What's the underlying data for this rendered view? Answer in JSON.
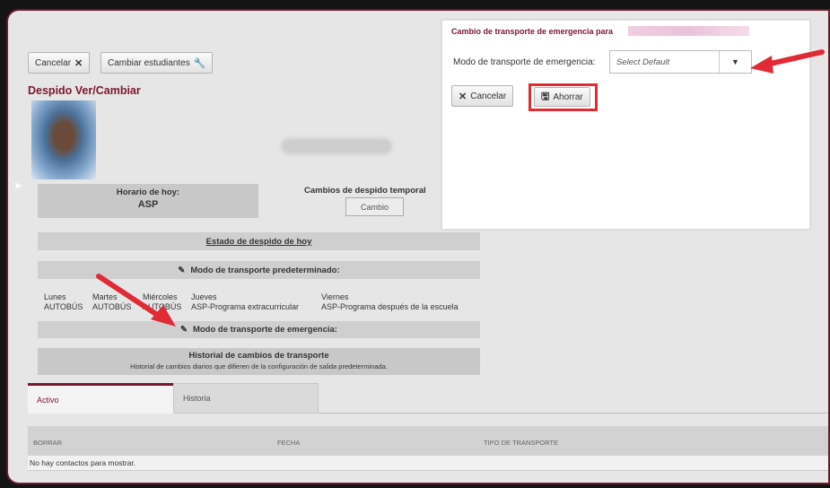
{
  "toolbar": {
    "cancel_label": "Cancelar",
    "change_students_label": "Cambiar estudiantes"
  },
  "page": {
    "title": "Despido Ver/Cambiar"
  },
  "schedule": {
    "label": "Horario de hoy:",
    "value": "ASP"
  },
  "temporary_changes": {
    "title": "Cambios de despido temporal",
    "button_label": "Cambio"
  },
  "status_bar": {
    "label": "Estado de despido de hoy"
  },
  "default_mode": {
    "label": "Modo de transporte predeterminado:"
  },
  "week": [
    {
      "day": "Lunes",
      "mode": "AUTOBÚS"
    },
    {
      "day": "Martes",
      "mode": "AUTOBÚS"
    },
    {
      "day": "Miércoles",
      "mode": "AUTOBÚS"
    },
    {
      "day": "Jueves",
      "mode": "ASP-Programa extracurricular"
    },
    {
      "day": "Viernes",
      "mode": "ASP-Programa después de la escuela"
    }
  ],
  "emergency_mode": {
    "label": "Modo de transporte de emergencia:"
  },
  "history": {
    "title": "Historial de cambios de transporte",
    "subtitle": "Historial de cambios diarios que difieren de la configuración de salida predeterminada."
  },
  "tabs": [
    {
      "label": "Activo"
    },
    {
      "label": "Historia"
    }
  ],
  "table": {
    "columns": [
      "BORRAR",
      "FECHA",
      "TIPO DE TRANSPORTE"
    ],
    "empty_message": "No hay contactos para mostrar."
  },
  "modal": {
    "title": "Cambio de transporte de emergencia para",
    "field_label": "Modo de transporte de emergencia:",
    "select_value": "Select Default",
    "cancel_label": "Cancelar",
    "save_label": "Ahorrar"
  },
  "colors": {
    "accent": "#7a1630",
    "highlight": "#e02b35"
  }
}
